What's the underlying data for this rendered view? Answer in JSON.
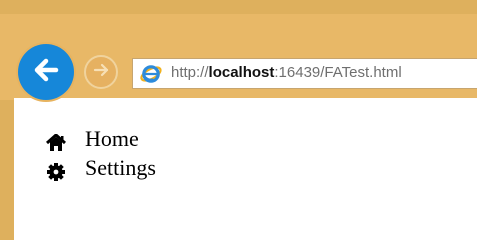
{
  "browser": {
    "address": {
      "protocol": "http://",
      "host": "localhost",
      "rest": ":16439/FATest.html"
    },
    "icons": {
      "back": "back-arrow-icon",
      "forward": "forward-arrow-icon",
      "site": "internet-explorer-icon"
    }
  },
  "page": {
    "menu": [
      {
        "label": "Home",
        "icon": "home-icon"
      },
      {
        "label": "Settings",
        "icon": "gear-icon"
      }
    ]
  },
  "colors": {
    "frame": "#e8b867",
    "back_button": "#1687d9",
    "url_text": "#6f6f6f"
  }
}
